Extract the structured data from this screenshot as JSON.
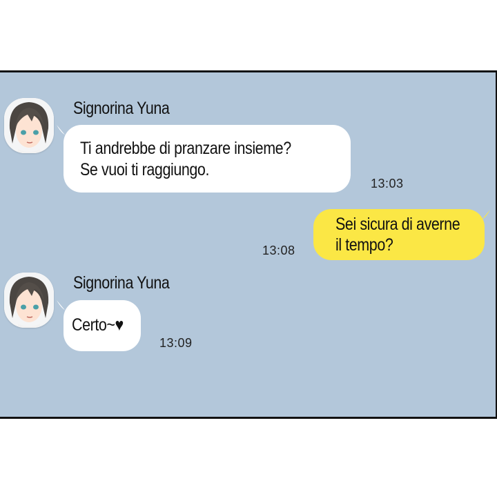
{
  "messages": [
    {
      "sender": "Signorina Yuna",
      "lines": [
        "Ti andrebbe di pranzare insieme?",
        "Se vuoi ti raggiungo."
      ],
      "time": "13:03",
      "direction": "incoming"
    },
    {
      "sender": "",
      "lines": [
        "Sei sicura di averne",
        "il tempo?"
      ],
      "time": "13:08",
      "direction": "outgoing"
    },
    {
      "sender": "Signorina Yuna",
      "lines": [
        "Certo~♥"
      ],
      "time": "13:09",
      "direction": "incoming"
    }
  ],
  "colors": {
    "chat_background": "#b3c7da",
    "incoming_bubble": "#ffffff",
    "outgoing_bubble": "#fbe745",
    "border": "#111111"
  },
  "icons": [
    "avatar-yuna-icon"
  ]
}
